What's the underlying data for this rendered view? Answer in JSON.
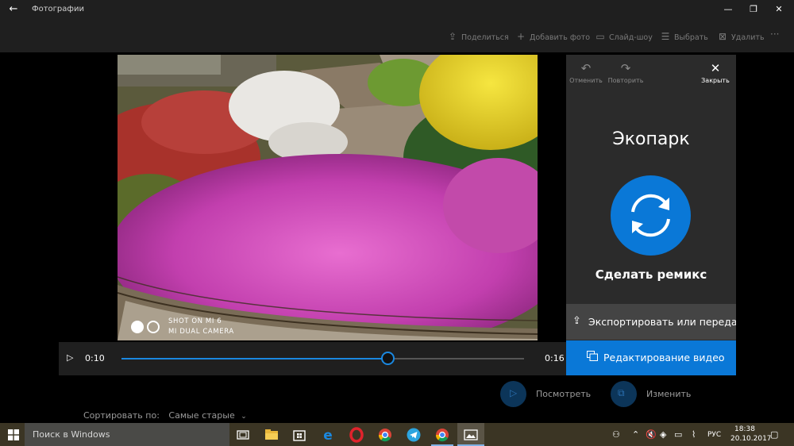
{
  "titlebar": {
    "back_icon": "back-arrow-icon",
    "title": "Фотографии",
    "minimize_icon": "minimize-icon",
    "maximize_icon": "restore-icon",
    "close_icon": "close-icon"
  },
  "commandbar": {
    "share": "Поделиться",
    "add_photo": "Добавить фото",
    "slideshow": "Слайд-шоу",
    "select": "Выбрать",
    "delete": "Удалить",
    "more": "···"
  },
  "photo": {
    "watermark_line1": "SHOT ON MI 6",
    "watermark_line2": "MI DUAL CAMERA"
  },
  "video": {
    "current_time": "0:10",
    "total_time": "0:16",
    "progress": 0.66
  },
  "panel": {
    "undo": "Отменить",
    "redo": "Повторить",
    "close": "Закрыть",
    "title": "Экопарк",
    "remix_label": "Сделать ремикс",
    "export_label": "Экспортировать или передать",
    "edit_video_label": "Редактирование видео"
  },
  "bottom": {
    "watch": "Посмотреть",
    "change": "Изменить",
    "sort_label": "Сортировать по:",
    "sort_value": "Самые старые"
  },
  "taskbar": {
    "search_placeholder": "Поиск в Windows",
    "language": "РУС",
    "time": "18:38",
    "date": "20.10.2017"
  },
  "colors": {
    "accent": "#0a78d7",
    "panel_bg": "#2b2b2b",
    "bar_bg": "#1f1f1f",
    "taskbar_bg": "#3b3524"
  }
}
